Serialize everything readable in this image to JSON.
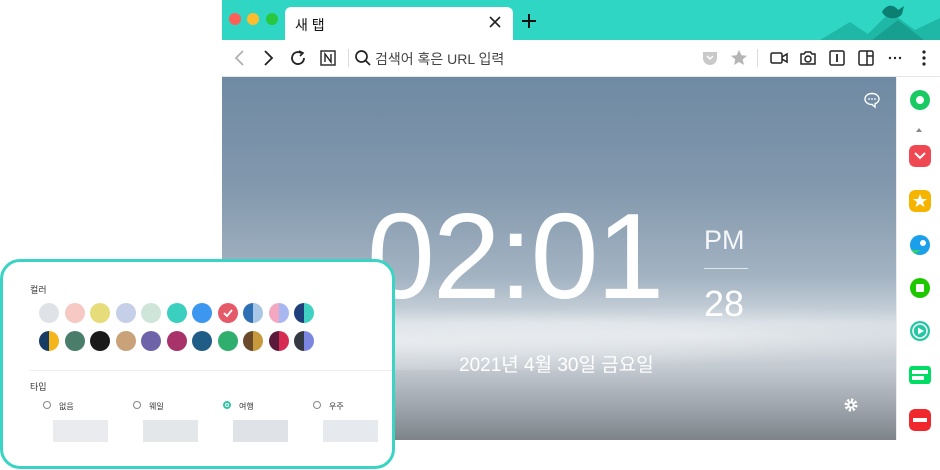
{
  "tab": {
    "title": "새 탭"
  },
  "address_bar": {
    "placeholder": "검색어 혹은 URL 입력"
  },
  "clock": {
    "time": "02:01",
    "ampm": "PM",
    "seconds": "28",
    "date": "2021년 4월 30일 금요일"
  },
  "settings": {
    "color_label": "컬러",
    "type_label": "타입",
    "colors_row1": [
      {
        "left": "#dfe3e8",
        "right": "#dfe3e8"
      },
      {
        "left": "#f6c9c4",
        "right": "#f6c9c4"
      },
      {
        "left": "#e6dc7a",
        "right": "#e6dc7a"
      },
      {
        "left": "#c5cfe8",
        "right": "#c5cfe8"
      },
      {
        "left": "#cfe5d9",
        "right": "#cfe5d9"
      },
      {
        "left": "#3bcfbf",
        "right": "#3bcfbf"
      },
      {
        "left": "#3b97f0",
        "right": "#3b97f0"
      },
      {
        "left": "#e55a68",
        "right": "#e55a68",
        "selected": true
      },
      {
        "left": "#2f6fb3",
        "right": "#a9c6e6"
      },
      {
        "left": "#f4a7c0",
        "right": "#a7b7f2"
      },
      {
        "left": "#1f3f7a",
        "right": "#3fd1c1"
      }
    ],
    "colors_row2": [
      {
        "left": "#163c63",
        "right": "#f5b51c"
      },
      {
        "left": "#4a7d6a",
        "right": "#4a7d6a"
      },
      {
        "left": "#1a1a1a",
        "right": "#1a1a1a"
      },
      {
        "left": "#c9a27a",
        "right": "#c9a27a"
      },
      {
        "left": "#6e63a8",
        "right": "#6e63a8"
      },
      {
        "left": "#a8326a",
        "right": "#a8326a"
      },
      {
        "left": "#1f5c86",
        "right": "#1f5c86"
      },
      {
        "left": "#2fae6e",
        "right": "#2fae6e"
      },
      {
        "left": "#6b4a2b",
        "right": "#c79a3e"
      },
      {
        "left": "#5a1a3a",
        "right": "#d62c54"
      },
      {
        "left": "#333842",
        "right": "#7b86e0"
      }
    ],
    "types": [
      {
        "label": "없음",
        "selected": false
      },
      {
        "label": "웨일",
        "selected": false
      },
      {
        "label": "여행",
        "selected": true
      },
      {
        "label": "우주",
        "selected": false
      }
    ]
  },
  "colors": {
    "accent": "#2fd6c3",
    "card_border": "#3ad4c5"
  }
}
